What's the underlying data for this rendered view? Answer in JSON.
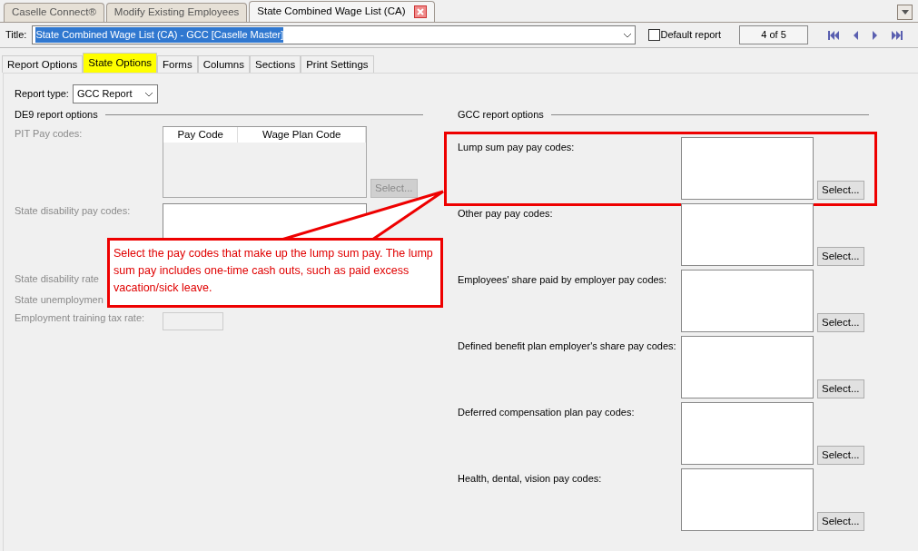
{
  "document_tabs": [
    {
      "label": "Caselle Connect®",
      "selected": false
    },
    {
      "label": "Modify Existing Employees",
      "selected": false
    },
    {
      "label": "State Combined Wage List (CA)",
      "selected": true
    }
  ],
  "title": {
    "label": "Title:",
    "value": "State Combined Wage List (CA) - GCC [Caselle Master]",
    "highlighted": true
  },
  "default_report": {
    "label": "Default report",
    "checked": false
  },
  "record_counter": "4 of 5",
  "option_tabs": [
    {
      "label": "Report Options",
      "selected": false
    },
    {
      "label": "State Options",
      "selected": true
    },
    {
      "label": "Forms",
      "selected": false
    },
    {
      "label": "Columns",
      "selected": false
    },
    {
      "label": "Sections",
      "selected": false
    },
    {
      "label": "Print Settings",
      "selected": false
    }
  ],
  "report_type": {
    "label": "Report type:",
    "value": "GCC Report"
  },
  "de9": {
    "heading": "DE9 report options",
    "disabled": true,
    "pit": {
      "label": "PIT Pay codes:",
      "columns": [
        "Pay Code",
        "Wage Plan Code"
      ],
      "button": "Select..."
    },
    "sdi": {
      "label": "State disability pay codes:"
    },
    "rates": [
      {
        "label": "State disability rate",
        "kind": "covered"
      },
      {
        "label": "State unemploymen",
        "kind": "covered"
      },
      {
        "label": "Employment training tax rate:",
        "kind": "field"
      }
    ]
  },
  "gcc": {
    "heading": "GCC report options",
    "groups": [
      {
        "label": "Lump sum pay pay codes:",
        "button": "Select...",
        "highlighted": true
      },
      {
        "label": "Other pay pay codes:",
        "button": "Select...",
        "highlighted": false
      },
      {
        "label": "Employees' share paid by employer pay codes:",
        "button": "Select...",
        "highlighted": false
      },
      {
        "label": "Defined benefit plan employer's share pay codes:",
        "button": "Select...",
        "highlighted": false
      },
      {
        "label": "Deferred compensation plan pay codes:",
        "button": "Select...",
        "highlighted": false
      },
      {
        "label": "Health, dental, vision pay codes:",
        "button": "Select...",
        "highlighted": false
      }
    ]
  },
  "callout": {
    "text": "Select the pay codes that make up the lump sum pay. The lump sum pay includes one-time cash outs, such as paid excess vacation/sick leave."
  }
}
